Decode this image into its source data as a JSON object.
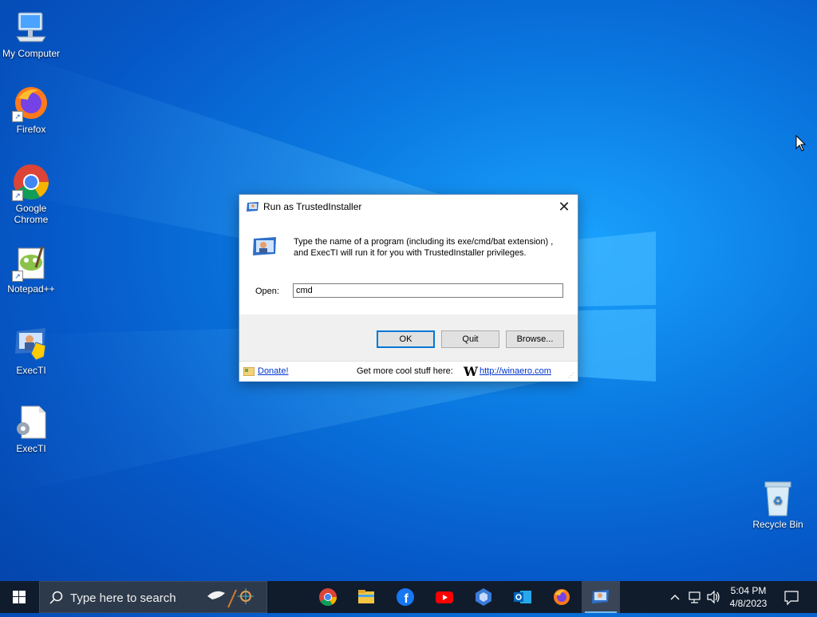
{
  "desktop": {
    "icons": [
      {
        "label_line1": "My Computer",
        "label_line2": "",
        "icon": "monitor-icon"
      },
      {
        "label_line1": "Firefox",
        "label_line2": "",
        "icon": "firefox-icon"
      },
      {
        "label_line1": "Google",
        "label_line2": "Chrome",
        "icon": "chrome-icon"
      },
      {
        "label_line1": "Notepad++",
        "label_line2": "",
        "icon": "notepadpp-icon"
      },
      {
        "label_line1": "ExecTI",
        "label_line2": "",
        "icon": "execti-shield-icon"
      },
      {
        "label_line1": "ExecTI",
        "label_line2": "",
        "icon": "file-gear-icon"
      },
      {
        "label_line1": "Recycle Bin",
        "label_line2": "",
        "icon": "recycle-bin-icon"
      }
    ]
  },
  "dialog": {
    "title": "Run as TrustedInstaller",
    "close_glyph": "✕",
    "description_line1": "Type the name of a program (including its exe/cmd/bat extension) ,",
    "description_line2": "and ExecTI will run it for you with TrustedInstaller privileges.",
    "open_label": "Open:",
    "open_value": "cmd",
    "buttons": {
      "ok": "OK",
      "quit": "Quit",
      "browse": "Browse..."
    },
    "footer": {
      "donate": "Donate!",
      "more_text": "Get more cool stuff here:",
      "w_logo": "W",
      "link": "http://winaero.com"
    }
  },
  "taskbar": {
    "search_placeholder": "Type here to search",
    "apps": [
      "chrome-icon",
      "file-explorer-icon",
      "facebook-icon",
      "youtube-icon",
      "copilot-icon",
      "outlook-icon",
      "firefox-icon",
      "execti-icon"
    ],
    "clock_time": "5:04 PM",
    "clock_date": "4/8/2023"
  },
  "colors": {
    "accent": "#0078d7",
    "taskbar": "#101c2c",
    "link": "#0033cc"
  }
}
